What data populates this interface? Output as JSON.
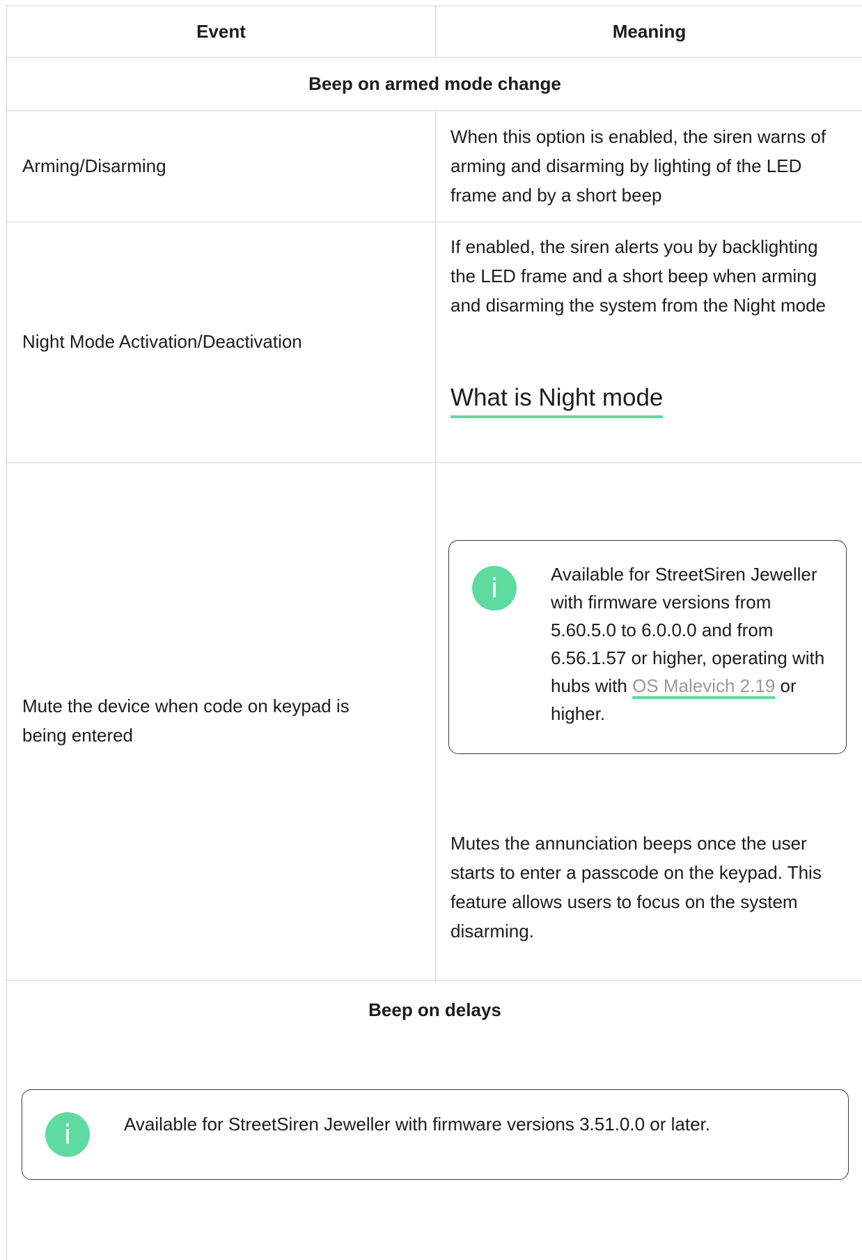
{
  "table": {
    "headers": {
      "event": "Event",
      "meaning": "Meaning"
    },
    "section_armed": "Beep on armed mode change",
    "rows": [
      {
        "event": "Arming/Disarming",
        "meaning": "When this option is enabled, the siren warns of arming and disarming by lighting of the LED frame and by a short beep"
      },
      {
        "event": "Night Mode Activation/Deactivation",
        "meaning": "If enabled, the siren alerts you by backlighting the LED frame and a short beep when arming and disarming the system from the Night mode",
        "link": "What is Night mode"
      },
      {
        "event": "Mute the device when code on keypad is being entered",
        "notice_before": "Available for StreetSiren Jeweller with firmware versions from 5.60.5.0 to 6.0.0.0 and from 6.56.1.57 or higher, operating with hubs with ",
        "notice_link": "OS Malevich 2.19",
        "notice_after": " or higher.",
        "meaning": "Mutes the annunciation beeps once the user starts to enter a passcode on the keypad. This feature allows users to focus on the system disarming."
      }
    ],
    "section_delays": "Beep on delays",
    "delays_notice": "Available for StreetSiren Jeweller with firmware versions 3.51.0.0 or later."
  },
  "icons": {
    "info": "info-icon"
  },
  "colors": {
    "accent": "#5fdba0",
    "border": "#d3d3d3",
    "link_text": "#9a9a9a"
  }
}
